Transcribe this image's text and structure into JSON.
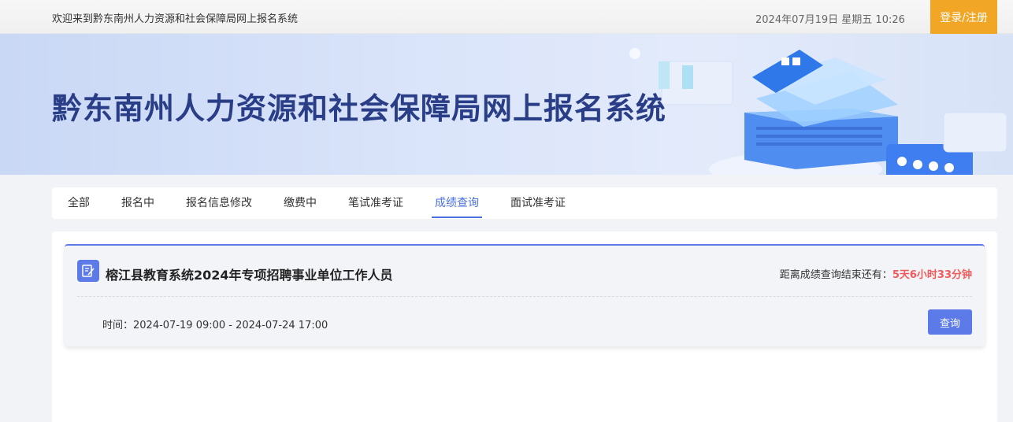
{
  "topbar": {
    "welcome": "欢迎来到黔东南州人力资源和社会保障局网上报名系统",
    "datetime": "2024年07月19日 星期五 10:26",
    "login_label": "登录/注册"
  },
  "banner": {
    "title": "黔东南州人力资源和社会保障局网上报名系统"
  },
  "tabs": [
    {
      "label": "全部"
    },
    {
      "label": "报名中"
    },
    {
      "label": "报名信息修改"
    },
    {
      "label": "缴费中"
    },
    {
      "label": "笔试准考证"
    },
    {
      "label": "成绩查询"
    },
    {
      "label": "面试准考证"
    }
  ],
  "active_tab": "成绩查询",
  "card": {
    "icon": "document-edit-icon",
    "title": "榕江县教育系统2024年专项招聘事业单位工作人员",
    "countdown_label": "距离成绩查询结束还有：",
    "countdown_value": "5天6小时33分钟",
    "time_label": "时间：",
    "time_value": "2024-07-19 09:00 - 2024-07-24 17:00",
    "query_label": "查询"
  },
  "colors": {
    "accent": "#5c7ae8",
    "login": "#f2a626",
    "countdown": "#f05a5a",
    "title": "#2a3d87"
  }
}
